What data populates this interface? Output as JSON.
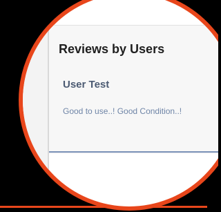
{
  "reviews": {
    "section_title": "Reviews by Users",
    "items": [
      {
        "author": "User Test",
        "comment": "Good to use..! Good Condition..!"
      }
    ]
  },
  "colors": {
    "highlight": "#e8461b",
    "title": "#1f1f1f",
    "author": "#4c5b73",
    "comment": "#6f85a7",
    "divider": "#7990b6"
  }
}
